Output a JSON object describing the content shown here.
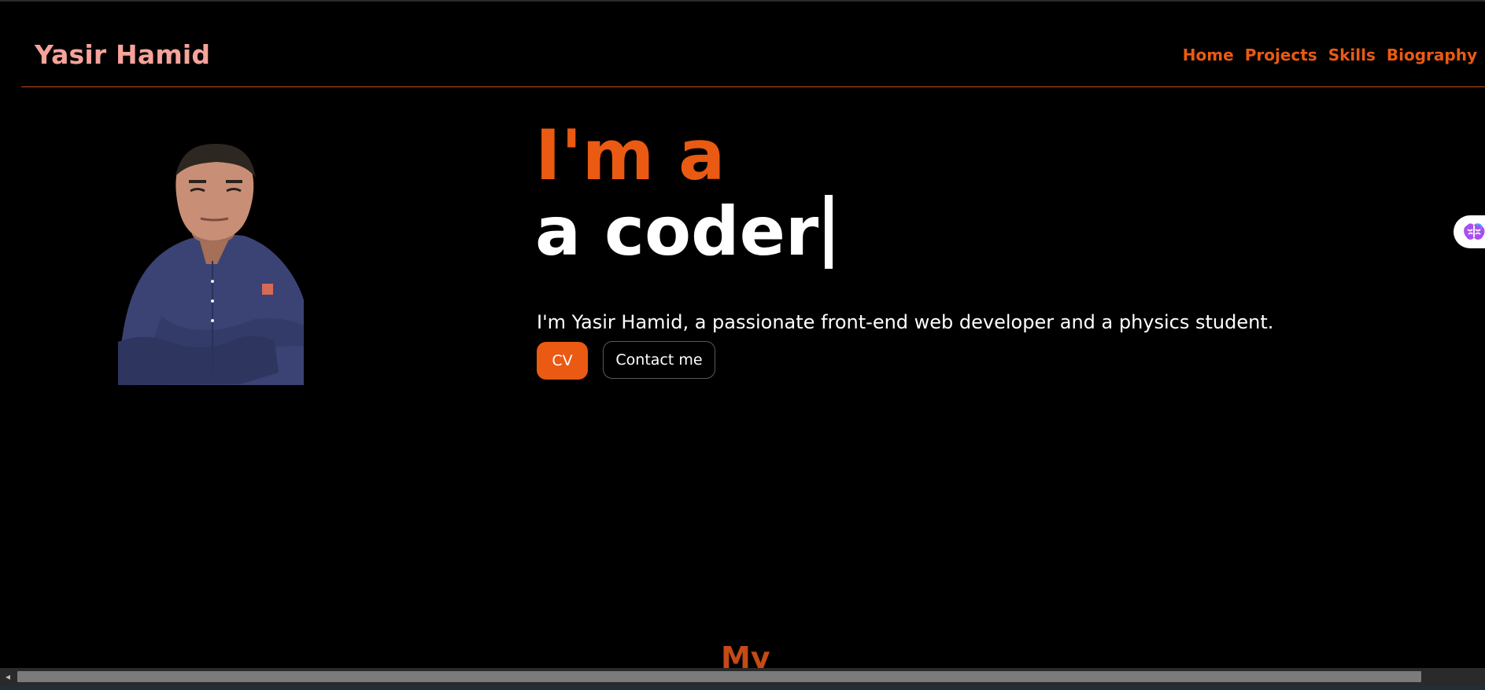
{
  "brand": {
    "name": "Yasir Hamid"
  },
  "nav": {
    "items": [
      "Home",
      "Projects",
      "Skills",
      "Biography"
    ]
  },
  "hero": {
    "line1": "I'm a",
    "line2": "a coder",
    "tagline": "I'm Yasir Hamid, a passionate front-end web developer and a physics student.",
    "cv_button": "CV",
    "contact_button": "Contact me"
  },
  "next_section": {
    "heading_peek": "My"
  },
  "colors": {
    "accent": "#ea5a12",
    "brand": "#f6a39a",
    "background": "#000000",
    "text": "#ffffff"
  },
  "icons": {
    "widget": "brain-icon",
    "scroll_left": "scroll-left-arrow-icon"
  }
}
